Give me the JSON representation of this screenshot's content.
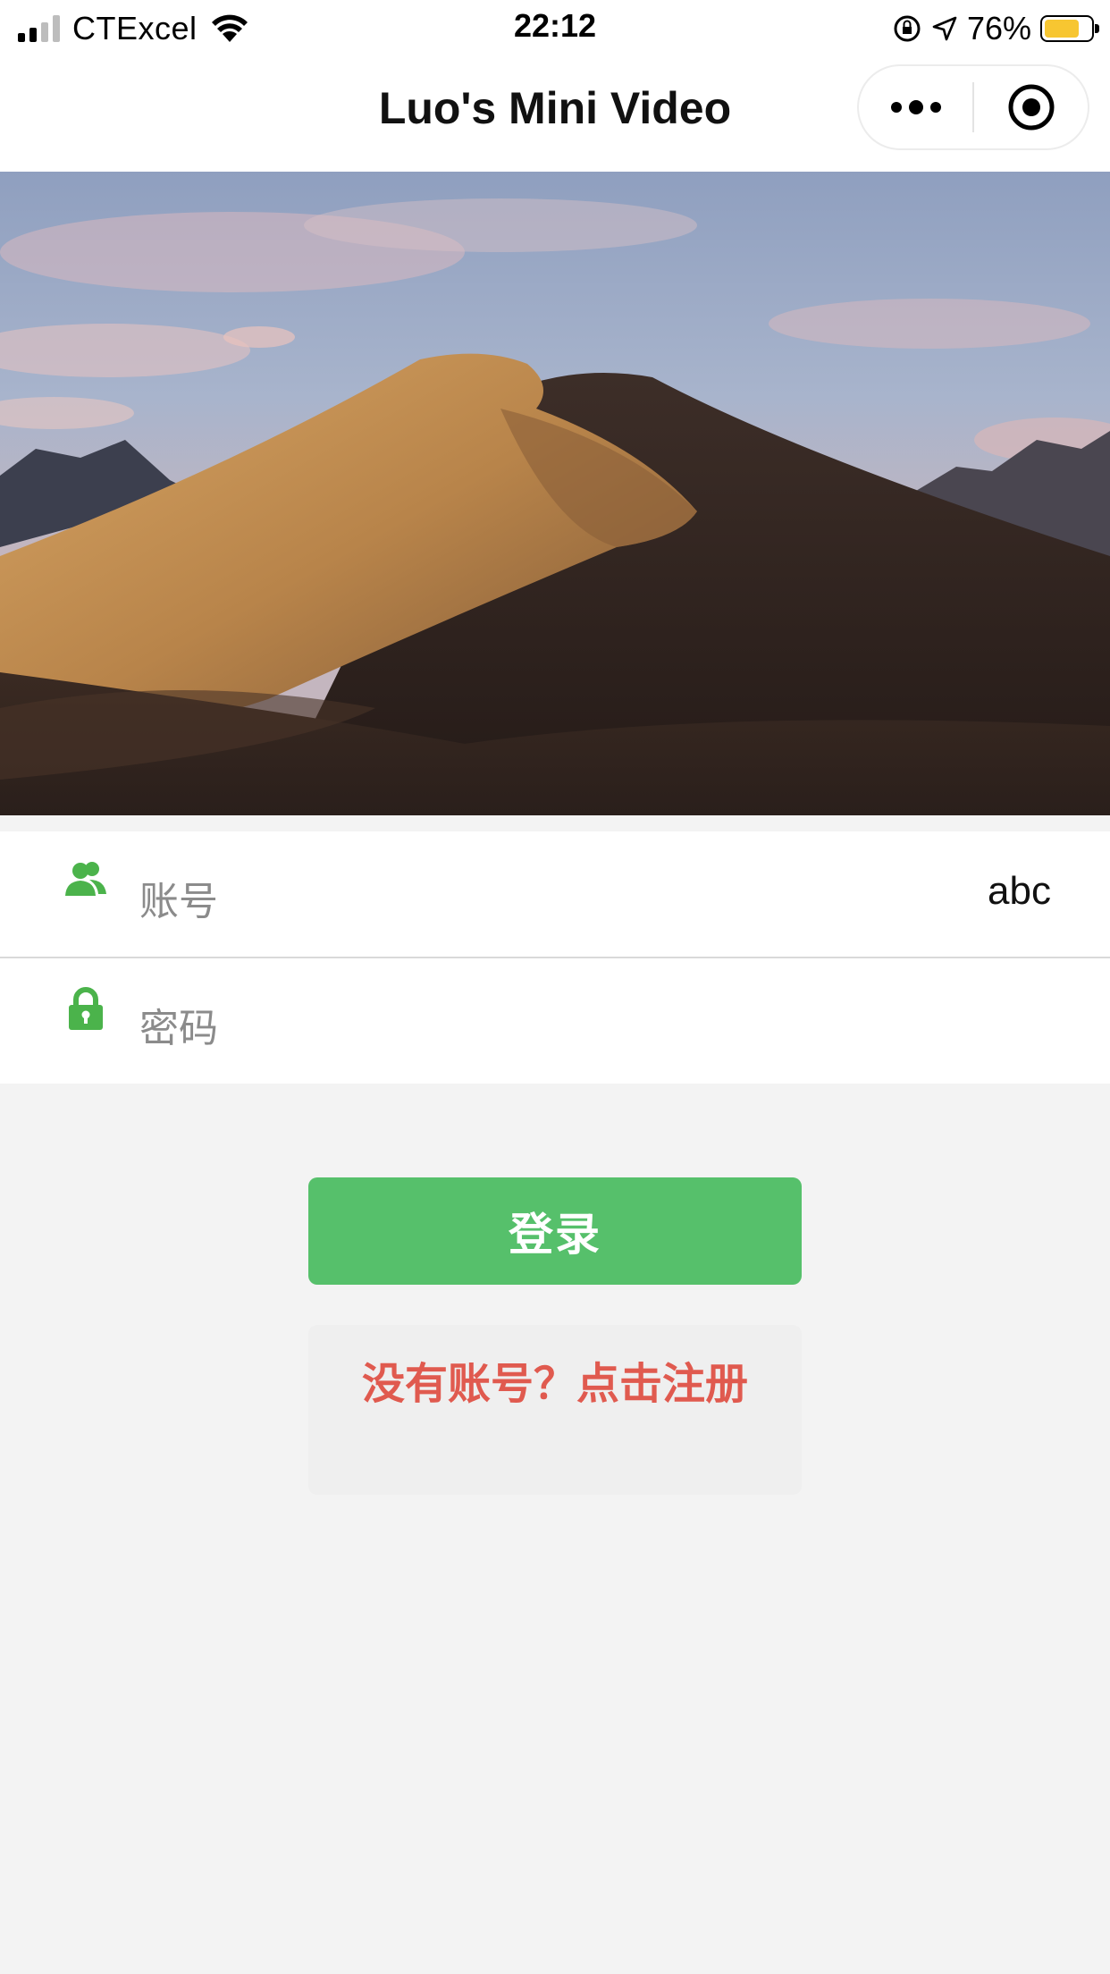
{
  "status_bar": {
    "carrier": "CTExcel",
    "time": "22:12",
    "battery_percent": "76%",
    "battery_level": 0.76,
    "battery_color": "#f7c631"
  },
  "nav": {
    "title": "Luo's Mini Video",
    "more_icon": "more-dots-icon",
    "close_icon": "target-circle-icon"
  },
  "banner": {
    "icon": "desert-dune-image"
  },
  "form": {
    "account_label": "账号",
    "account_value": "abc",
    "account_icon": "users-icon",
    "password_label": "密码",
    "password_value": "",
    "password_icon": "lock-icon",
    "accent_color": "#4bb34b"
  },
  "actions": {
    "login_label": "登录",
    "login_color": "#56c06b",
    "register_label": "没有账号？点击注册",
    "register_color": "#e05a4f"
  }
}
